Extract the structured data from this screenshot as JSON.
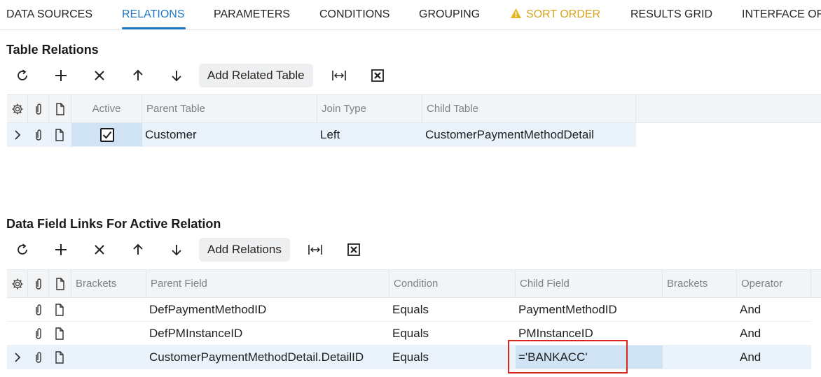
{
  "tabs": [
    {
      "label": "DATA SOURCES"
    },
    {
      "label": "RELATIONS"
    },
    {
      "label": "PARAMETERS"
    },
    {
      "label": "CONDITIONS"
    },
    {
      "label": "GROUPING"
    },
    {
      "label": "SORT ORDER"
    },
    {
      "label": "RESULTS GRID"
    },
    {
      "label": "INTERFACE OF"
    }
  ],
  "colors": {
    "accent": "#1d77c4",
    "warning": "#d6a51c",
    "highlight_box": "#d9261c",
    "selected_row": "#eaf3fb"
  },
  "table_relations": {
    "title": "Table Relations",
    "toolbar": {
      "add_button": "Add Related Table"
    },
    "columns": [
      "Active",
      "Parent Table",
      "Join Type",
      "Child Table"
    ],
    "rows": [
      {
        "active": true,
        "parent_table": "Customer",
        "join_type": "Left",
        "child_table": "CustomerPaymentMethodDetail"
      }
    ]
  },
  "data_field_links": {
    "title": "Data Field Links For Active Relation",
    "toolbar": {
      "add_button": "Add Relations"
    },
    "columns": [
      "Brackets",
      "Parent Field",
      "Condition",
      "Child Field",
      "Brackets",
      "Operator"
    ],
    "rows": [
      {
        "brackets_open": "",
        "parent_field": "DefPaymentMethodID",
        "condition": "Equals",
        "child_field": "PaymentMethodID",
        "brackets_close": "",
        "operator": "And"
      },
      {
        "brackets_open": "",
        "parent_field": "DefPMInstanceID",
        "condition": "Equals",
        "child_field": "PMInstanceID",
        "brackets_close": "",
        "operator": "And"
      },
      {
        "brackets_open": "",
        "parent_field": "CustomerPaymentMethodDetail.DetailID",
        "condition": "Equals",
        "child_field": "='BANKACC'",
        "brackets_close": "",
        "operator": "And"
      }
    ]
  }
}
